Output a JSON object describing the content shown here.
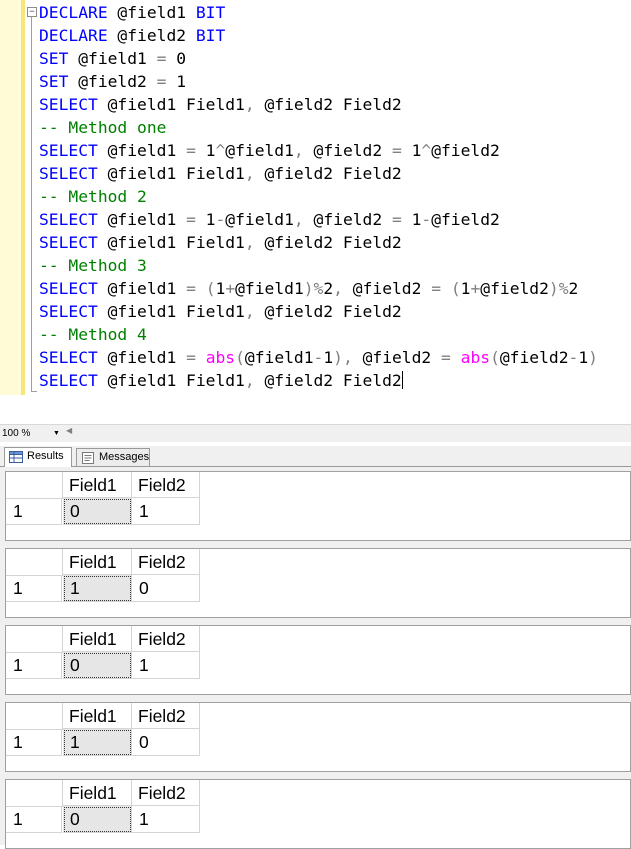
{
  "editor": {
    "lines": [
      [
        {
          "t": "DECLARE",
          "c": "kw"
        },
        {
          "t": " @field1 ",
          "c": ""
        },
        {
          "t": "BIT",
          "c": "kw"
        }
      ],
      [
        {
          "t": "DECLARE",
          "c": "kw"
        },
        {
          "t": " @field2 ",
          "c": ""
        },
        {
          "t": "BIT",
          "c": "kw"
        }
      ],
      [
        {
          "t": "SET",
          "c": "kw"
        },
        {
          "t": " @field1 ",
          "c": ""
        },
        {
          "t": "=",
          "c": "op"
        },
        {
          "t": " 0",
          "c": ""
        }
      ],
      [
        {
          "t": "SET",
          "c": "kw"
        },
        {
          "t": " @field2 ",
          "c": ""
        },
        {
          "t": "=",
          "c": "op"
        },
        {
          "t": " 1",
          "c": ""
        }
      ],
      [
        {
          "t": "SELECT",
          "c": "kw"
        },
        {
          "t": " @field1 Field1",
          "c": ""
        },
        {
          "t": ",",
          "c": "op"
        },
        {
          "t": " @field2 Field2",
          "c": ""
        }
      ],
      [
        {
          "t": "-- Method one",
          "c": "cm"
        }
      ],
      [
        {
          "t": "SELECT",
          "c": "kw"
        },
        {
          "t": " @field1 ",
          "c": ""
        },
        {
          "t": "=",
          "c": "op"
        },
        {
          "t": " 1",
          "c": ""
        },
        {
          "t": "^",
          "c": "op"
        },
        {
          "t": "@field1",
          "c": ""
        },
        {
          "t": ",",
          "c": "op"
        },
        {
          "t": " @field2 ",
          "c": ""
        },
        {
          "t": "=",
          "c": "op"
        },
        {
          "t": " 1",
          "c": ""
        },
        {
          "t": "^",
          "c": "op"
        },
        {
          "t": "@field2",
          "c": ""
        }
      ],
      [
        {
          "t": "SELECT",
          "c": "kw"
        },
        {
          "t": " @field1 Field1",
          "c": ""
        },
        {
          "t": ",",
          "c": "op"
        },
        {
          "t": " @field2 Field2",
          "c": ""
        }
      ],
      [
        {
          "t": "-- Method 2",
          "c": "cm"
        }
      ],
      [
        {
          "t": "SELECT",
          "c": "kw"
        },
        {
          "t": " @field1 ",
          "c": ""
        },
        {
          "t": "=",
          "c": "op"
        },
        {
          "t": " 1",
          "c": ""
        },
        {
          "t": "-",
          "c": "op"
        },
        {
          "t": "@field1",
          "c": ""
        },
        {
          "t": ",",
          "c": "op"
        },
        {
          "t": " @field2 ",
          "c": ""
        },
        {
          "t": "=",
          "c": "op"
        },
        {
          "t": " 1",
          "c": ""
        },
        {
          "t": "-",
          "c": "op"
        },
        {
          "t": "@field2",
          "c": ""
        }
      ],
      [
        {
          "t": "SELECT",
          "c": "kw"
        },
        {
          "t": " @field1 Field1",
          "c": ""
        },
        {
          "t": ",",
          "c": "op"
        },
        {
          "t": " @field2 Field2",
          "c": ""
        }
      ],
      [
        {
          "t": "-- Method 3",
          "c": "cm"
        }
      ],
      [
        {
          "t": "SELECT",
          "c": "kw"
        },
        {
          "t": " @field1 ",
          "c": ""
        },
        {
          "t": "=",
          "c": "op"
        },
        {
          "t": " ",
          "c": ""
        },
        {
          "t": "(",
          "c": "op"
        },
        {
          "t": "1",
          "c": ""
        },
        {
          "t": "+",
          "c": "op"
        },
        {
          "t": "@field1",
          "c": ""
        },
        {
          "t": ")%",
          "c": "op"
        },
        {
          "t": "2",
          "c": ""
        },
        {
          "t": ",",
          "c": "op"
        },
        {
          "t": " @field2 ",
          "c": ""
        },
        {
          "t": "=",
          "c": "op"
        },
        {
          "t": " ",
          "c": ""
        },
        {
          "t": "(",
          "c": "op"
        },
        {
          "t": "1",
          "c": ""
        },
        {
          "t": "+",
          "c": "op"
        },
        {
          "t": "@field2",
          "c": ""
        },
        {
          "t": ")%",
          "c": "op"
        },
        {
          "t": "2",
          "c": ""
        }
      ],
      [
        {
          "t": "SELECT",
          "c": "kw"
        },
        {
          "t": " @field1 Field1",
          "c": ""
        },
        {
          "t": ",",
          "c": "op"
        },
        {
          "t": " @field2 Field2",
          "c": ""
        }
      ],
      [
        {
          "t": "-- Method 4",
          "c": "cm"
        }
      ],
      [
        {
          "t": "SELECT",
          "c": "kw"
        },
        {
          "t": " @field1 ",
          "c": ""
        },
        {
          "t": "=",
          "c": "op"
        },
        {
          "t": " ",
          "c": ""
        },
        {
          "t": "abs",
          "c": "fn"
        },
        {
          "t": "(",
          "c": "op"
        },
        {
          "t": "@field1",
          "c": ""
        },
        {
          "t": "-",
          "c": "op"
        },
        {
          "t": "1",
          "c": ""
        },
        {
          "t": "),",
          "c": "op"
        },
        {
          "t": " @field2 ",
          "c": ""
        },
        {
          "t": "=",
          "c": "op"
        },
        {
          "t": " ",
          "c": ""
        },
        {
          "t": "abs",
          "c": "fn"
        },
        {
          "t": "(",
          "c": "op"
        },
        {
          "t": "@field2",
          "c": ""
        },
        {
          "t": "-",
          "c": "op"
        },
        {
          "t": "1",
          "c": ""
        },
        {
          "t": ")",
          "c": "op"
        }
      ],
      [
        {
          "t": "SELECT",
          "c": "kw"
        },
        {
          "t": " @field1 Field1",
          "c": ""
        },
        {
          "t": ",",
          "c": "op"
        },
        {
          "t": " @field2 Field2",
          "c": ""
        }
      ]
    ],
    "colors": {
      "keyword": "#0000ff",
      "comment": "#008000",
      "operator": "#808080",
      "function": "#ff00ff"
    }
  },
  "zoom": {
    "value": "100 %"
  },
  "tabs": {
    "results": "Results",
    "messages": "Messages"
  },
  "results": [
    {
      "headers": [
        "Field1",
        "Field2"
      ],
      "row": "1",
      "values": [
        "0",
        "1"
      ]
    },
    {
      "headers": [
        "Field1",
        "Field2"
      ],
      "row": "1",
      "values": [
        "1",
        "0"
      ]
    },
    {
      "headers": [
        "Field1",
        "Field2"
      ],
      "row": "1",
      "values": [
        "0",
        "1"
      ]
    },
    {
      "headers": [
        "Field1",
        "Field2"
      ],
      "row": "1",
      "values": [
        "1",
        "0"
      ]
    },
    {
      "headers": [
        "Field1",
        "Field2"
      ],
      "row": "1",
      "values": [
        "0",
        "1"
      ]
    }
  ]
}
